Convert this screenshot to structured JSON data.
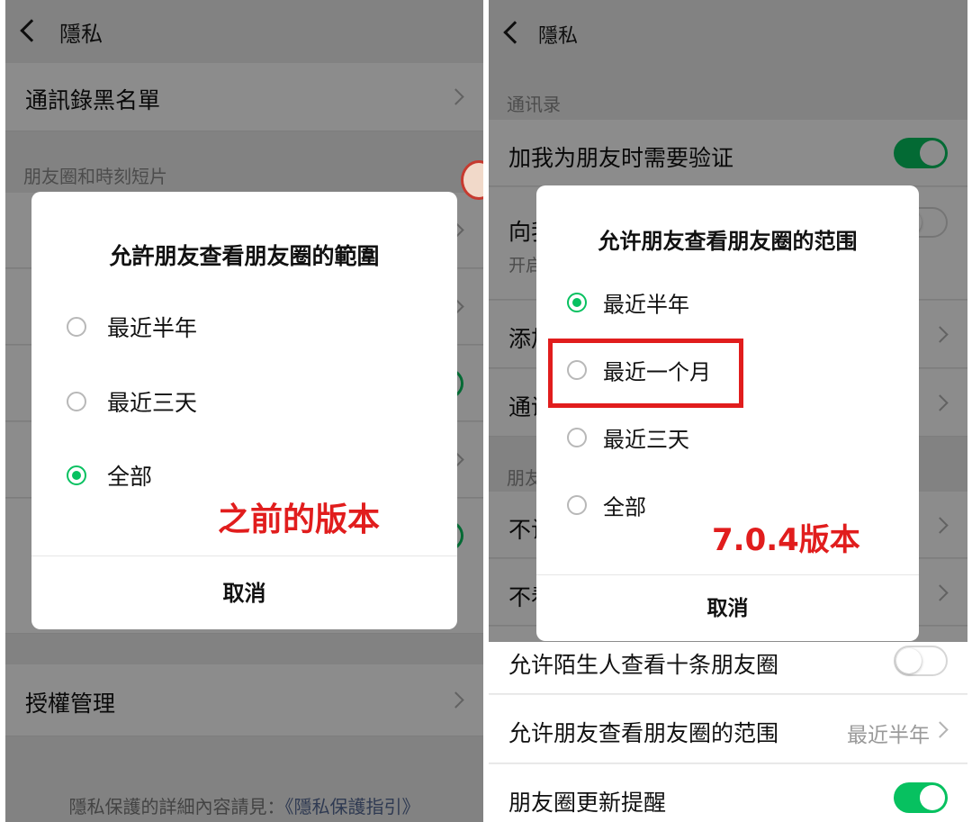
{
  "colors": {
    "accent": "#07c160",
    "annotation": "#e11d1d",
    "link": "#576b95"
  },
  "left": {
    "header_title": "隱私",
    "rows": [
      {
        "label": "通訊錄黑名單"
      }
    ],
    "section_moments": "朋友圈和時刻短片",
    "row_auth": "授權管理",
    "footer_prefix": "隱私保護的詳細內容請見：",
    "footer_link": "《隱私保護指引》",
    "dialog": {
      "title": "允許朋友查看朋友圈的範圍",
      "options": [
        {
          "label": "最近半年",
          "selected": false
        },
        {
          "label": "最近三天",
          "selected": false
        },
        {
          "label": "全部",
          "selected": true
        }
      ],
      "cancel": "取消"
    },
    "annotation": "之前的版本"
  },
  "right": {
    "header_title": "隱私",
    "section_contacts": "通讯录",
    "row_verify": {
      "label": "加我为朋友时需要验证",
      "toggle": "on"
    },
    "row_recommend": {
      "label": "向我",
      "sub": "开启",
      "toggle": "off"
    },
    "row_add": "添加",
    "row_contacts_blacklist": "通讯",
    "section_moments": "朋友",
    "row_hide_from": "不让",
    "row_hide_others": "不看",
    "row_strangers": {
      "label": "允许陌生人查看十条朋友圈",
      "toggle": "off"
    },
    "row_range": {
      "label": "允许朋友查看朋友圈的范围",
      "value": "最近半年"
    },
    "row_update": {
      "label": "朋友圈更新提醒",
      "toggle": "on"
    },
    "dialog": {
      "title": "允许朋友查看朋友圈的范围",
      "options": [
        {
          "label": "最近半年",
          "selected": true
        },
        {
          "label": "最近一个月",
          "selected": false
        },
        {
          "label": "最近三天",
          "selected": false
        },
        {
          "label": "全部",
          "selected": false
        }
      ],
      "cancel": "取消"
    },
    "annotation": "7.0.4版本"
  }
}
